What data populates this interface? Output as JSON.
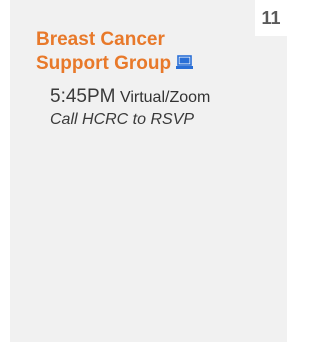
{
  "day": {
    "number": "11"
  },
  "event": {
    "title_line1": "Breast Cancer",
    "title_line2": "Support Group",
    "icon": "laptop-icon",
    "time": "5:45PM",
    "location": "Virtual/Zoom",
    "note": "Call HCRC to RSVP"
  },
  "colors": {
    "title": "#e8792a",
    "icon": "#2a6fd6",
    "cell_background": "#f1f1f1",
    "text": "#3a3a3a"
  }
}
